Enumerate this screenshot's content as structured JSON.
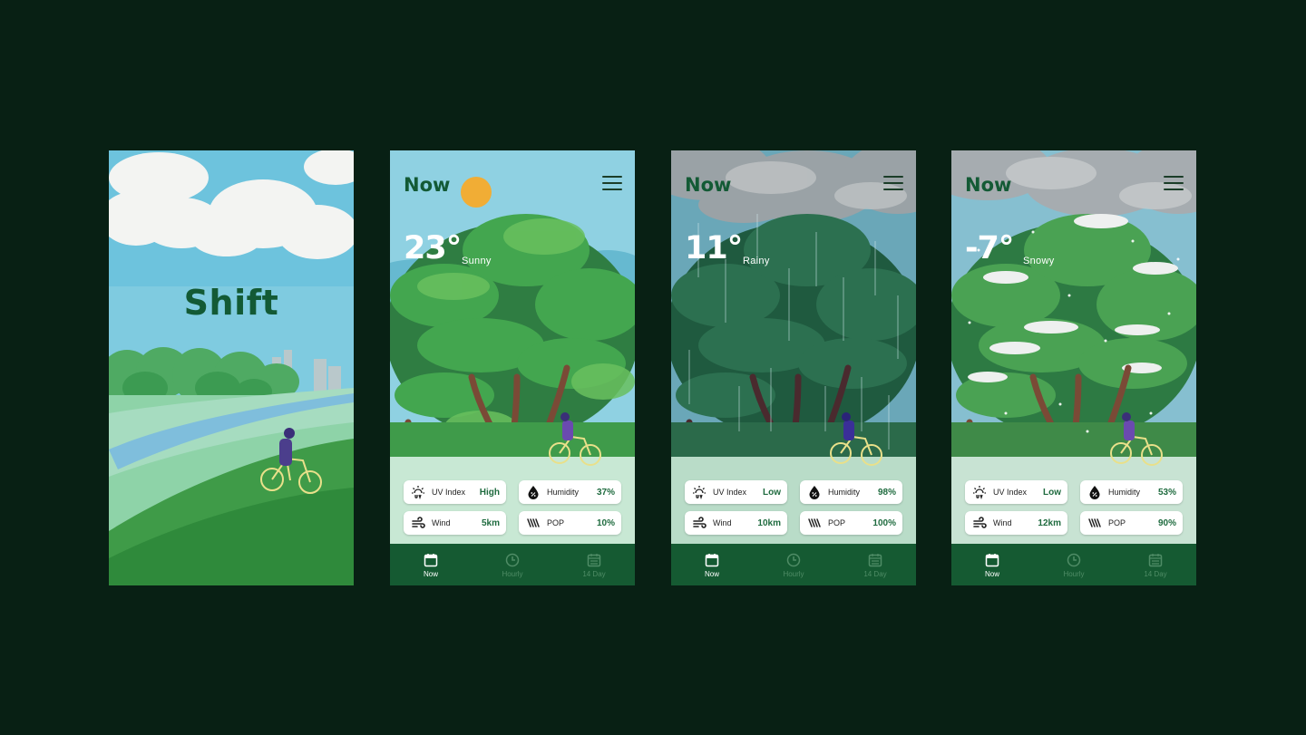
{
  "splash": {
    "title": "Shift"
  },
  "screens": [
    {
      "title": "Now",
      "temperature": "23°",
      "condition": "Sunny",
      "stats": [
        {
          "icon": "uv-icon",
          "label": "UV Index",
          "value": "High"
        },
        {
          "icon": "humidity-drop-icon",
          "label": "Humidity",
          "value": "37%"
        },
        {
          "icon": "wind-icon",
          "label": "Wind",
          "value": "5km"
        },
        {
          "icon": "precipitation-icon",
          "label": "POP",
          "value": "10%"
        }
      ]
    },
    {
      "title": "Now",
      "temperature": "11°",
      "condition": "Rainy",
      "stats": [
        {
          "icon": "uv-icon",
          "label": "UV Index",
          "value": "Low"
        },
        {
          "icon": "humidity-drop-icon",
          "label": "Humidity",
          "value": "98%"
        },
        {
          "icon": "wind-icon",
          "label": "Wind",
          "value": "10km"
        },
        {
          "icon": "precipitation-icon",
          "label": "POP",
          "value": "100%"
        }
      ]
    },
    {
      "title": "Now",
      "temperature": "-7°",
      "condition": "Snowy",
      "stats": [
        {
          "icon": "uv-icon",
          "label": "UV Index",
          "value": "Low"
        },
        {
          "icon": "humidity-drop-icon",
          "label": "Humidity",
          "value": "53%"
        },
        {
          "icon": "wind-icon",
          "label": "Wind",
          "value": "12km"
        },
        {
          "icon": "precipitation-icon",
          "label": "POP",
          "value": "90%"
        }
      ]
    }
  ],
  "tabs": [
    {
      "icon": "calendar-icon",
      "label": "Now",
      "active": true
    },
    {
      "icon": "clock-icon",
      "label": "Hourly",
      "active": false
    },
    {
      "icon": "calendar-grid-icon",
      "label": "14 Day",
      "active": false
    }
  ],
  "colors": {
    "background": "#082014",
    "brand_green": "#135a35",
    "tabbar": "#155a32",
    "value_green": "#1f6b3f"
  }
}
